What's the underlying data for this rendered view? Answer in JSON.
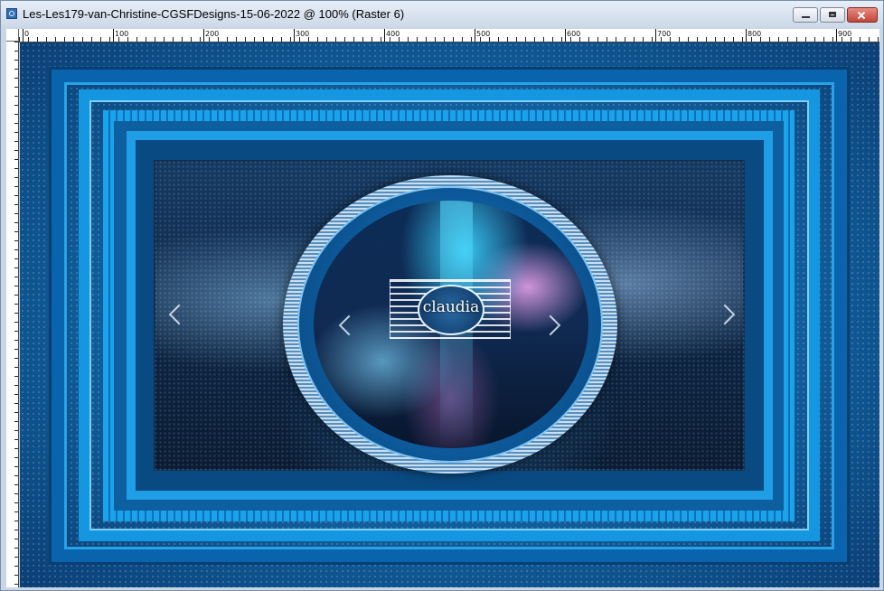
{
  "window": {
    "title": "Les-Les179-van-Christine-CGSFDesigns-15-06-2022 @ 100% (Raster 6)"
  },
  "ruler": {
    "top_labels": [
      "0",
      "100",
      "200",
      "300",
      "400",
      "500",
      "600",
      "700",
      "800",
      "900"
    ]
  },
  "canvas": {
    "watermark_text": "claudia"
  },
  "icons": {
    "app": "psp-document-icon",
    "minimize": "minimize-icon",
    "maximize": "maximize-icon",
    "close": "close-icon",
    "prev_outer": "chevron-left-icon",
    "next_outer": "chevron-right-icon",
    "prev_inner": "chevron-left-icon",
    "next_inner": "chevron-right-icon"
  },
  "colors": {
    "frame_primary": "#0a63ad",
    "frame_accent": "#29a3e6",
    "title_bar": "#cdd9e7"
  }
}
